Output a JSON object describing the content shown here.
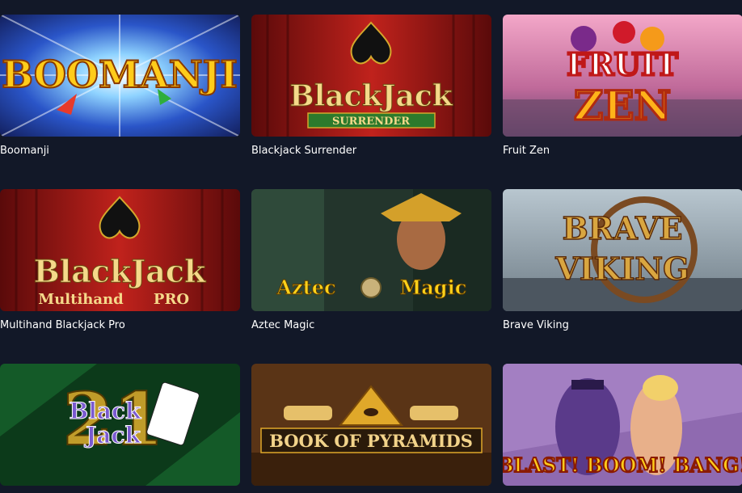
{
  "games": [
    {
      "name": "Boomanji",
      "logo": "BOOMANJI"
    },
    {
      "name": "Blackjack Surrender",
      "logo": "BlackJack",
      "sub": "SURRENDER"
    },
    {
      "name": "Fruit Zen",
      "logo": "FRUIT",
      "logo2": "ZEN"
    },
    {
      "name": "Multihand Blackjack Pro",
      "logo": "BlackJack",
      "sub": "Multihand",
      "sub2": "PRO"
    },
    {
      "name": "Aztec Magic",
      "logo": "Aztec",
      "logo2": "Magic"
    },
    {
      "name": "Brave Viking",
      "logo": "BRAVE",
      "logo2": "VIKING"
    },
    {
      "name": "",
      "logo": "Black",
      "logo2": "Jack",
      "badge": "21"
    },
    {
      "name": "",
      "logo": "BOOK OF PYRAMIDS"
    },
    {
      "name": "",
      "logo": "BLAST! BOOM! BANG!"
    }
  ],
  "colors": {
    "background": "#121828",
    "text": "#ffffff"
  }
}
